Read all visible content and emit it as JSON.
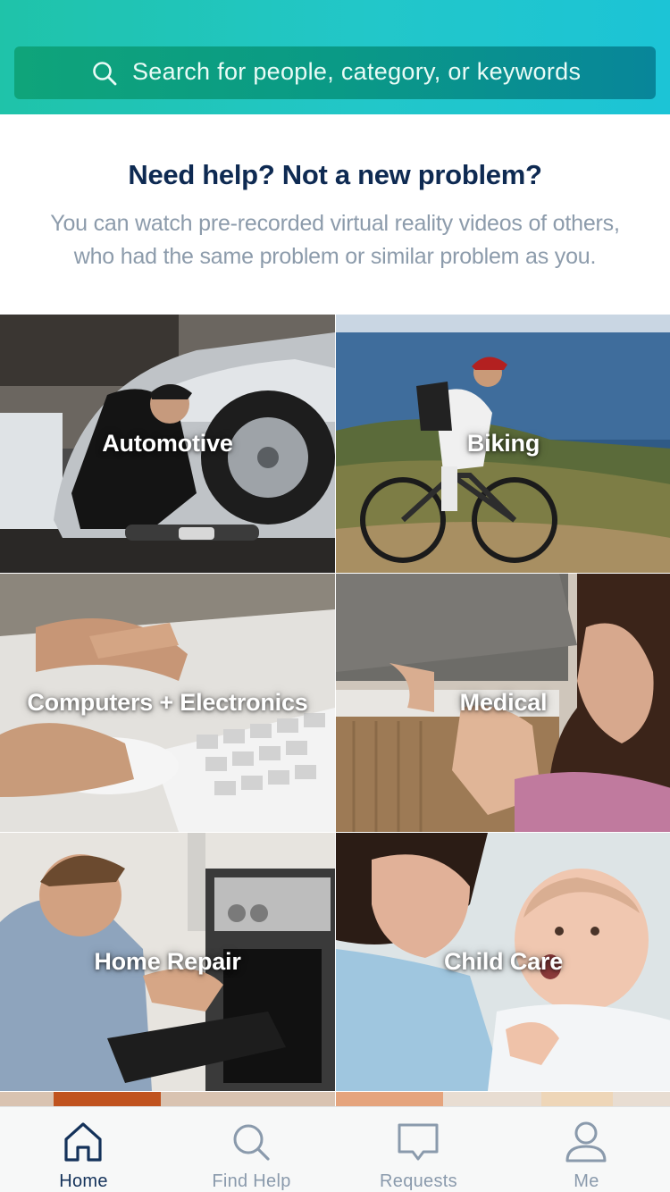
{
  "search": {
    "placeholder": "Search for people, category, or keywords",
    "icon": "search-icon"
  },
  "intro": {
    "title": "Need help? Not a new problem?",
    "body": "You can watch pre-recorded virtual reality videos of others, who had the same problem or similar problem as you."
  },
  "categories": [
    {
      "label": "Automotive"
    },
    {
      "label": "Biking"
    },
    {
      "label": "Computers + Electronics"
    },
    {
      "label": "Medical"
    },
    {
      "label": "Home Repair"
    },
    {
      "label": "Child Care"
    }
  ],
  "tabs": [
    {
      "label": "Home",
      "icon": "home-icon",
      "active": true
    },
    {
      "label": "Find Help",
      "icon": "search-icon",
      "active": false
    },
    {
      "label": "Requests",
      "icon": "chat-bubble-icon",
      "active": false
    },
    {
      "label": "Me",
      "icon": "person-icon",
      "active": false
    }
  ],
  "colors": {
    "header_start": "#1fc3a9",
    "header_end": "#1cc4d6",
    "title": "#0e2a52",
    "body_text": "#8c9bab",
    "tab_active": "#14325a",
    "tab_inactive": "#8a9aac"
  }
}
